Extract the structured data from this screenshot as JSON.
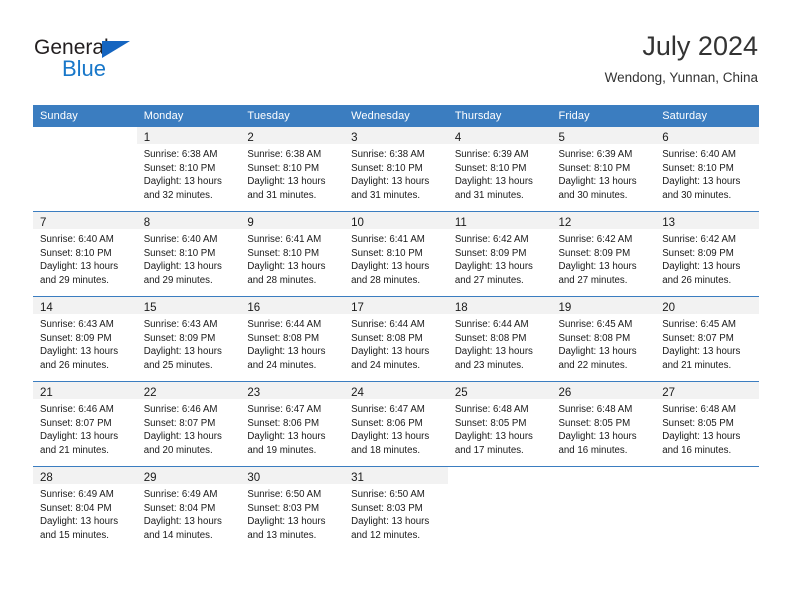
{
  "brand": {
    "name_top": "General",
    "name_bottom": "Blue",
    "accent_color": "#1877c9",
    "triangle_color": "#1565c0"
  },
  "header": {
    "title": "July 2024",
    "subtitle": "Wendong, Yunnan, China"
  },
  "theme": {
    "header_row_bg": "#3b7dc0",
    "header_row_text": "#ffffff",
    "daynum_band_bg": "#f2f2f2",
    "week_separator": "#3b7dc0",
    "text_color": "#1a1a1a"
  },
  "weekday_headers": [
    "Sunday",
    "Monday",
    "Tuesday",
    "Wednesday",
    "Thursday",
    "Friday",
    "Saturday"
  ],
  "weeks": [
    [
      {
        "day": "",
        "lines": []
      },
      {
        "day": "1",
        "lines": [
          "Sunrise: 6:38 AM",
          "Sunset: 8:10 PM",
          "Daylight: 13 hours",
          "and 32 minutes."
        ]
      },
      {
        "day": "2",
        "lines": [
          "Sunrise: 6:38 AM",
          "Sunset: 8:10 PM",
          "Daylight: 13 hours",
          "and 31 minutes."
        ]
      },
      {
        "day": "3",
        "lines": [
          "Sunrise: 6:38 AM",
          "Sunset: 8:10 PM",
          "Daylight: 13 hours",
          "and 31 minutes."
        ]
      },
      {
        "day": "4",
        "lines": [
          "Sunrise: 6:39 AM",
          "Sunset: 8:10 PM",
          "Daylight: 13 hours",
          "and 31 minutes."
        ]
      },
      {
        "day": "5",
        "lines": [
          "Sunrise: 6:39 AM",
          "Sunset: 8:10 PM",
          "Daylight: 13 hours",
          "and 30 minutes."
        ]
      },
      {
        "day": "6",
        "lines": [
          "Sunrise: 6:40 AM",
          "Sunset: 8:10 PM",
          "Daylight: 13 hours",
          "and 30 minutes."
        ]
      }
    ],
    [
      {
        "day": "7",
        "lines": [
          "Sunrise: 6:40 AM",
          "Sunset: 8:10 PM",
          "Daylight: 13 hours",
          "and 29 minutes."
        ]
      },
      {
        "day": "8",
        "lines": [
          "Sunrise: 6:40 AM",
          "Sunset: 8:10 PM",
          "Daylight: 13 hours",
          "and 29 minutes."
        ]
      },
      {
        "day": "9",
        "lines": [
          "Sunrise: 6:41 AM",
          "Sunset: 8:10 PM",
          "Daylight: 13 hours",
          "and 28 minutes."
        ]
      },
      {
        "day": "10",
        "lines": [
          "Sunrise: 6:41 AM",
          "Sunset: 8:10 PM",
          "Daylight: 13 hours",
          "and 28 minutes."
        ]
      },
      {
        "day": "11",
        "lines": [
          "Sunrise: 6:42 AM",
          "Sunset: 8:09 PM",
          "Daylight: 13 hours",
          "and 27 minutes."
        ]
      },
      {
        "day": "12",
        "lines": [
          "Sunrise: 6:42 AM",
          "Sunset: 8:09 PM",
          "Daylight: 13 hours",
          "and 27 minutes."
        ]
      },
      {
        "day": "13",
        "lines": [
          "Sunrise: 6:42 AM",
          "Sunset: 8:09 PM",
          "Daylight: 13 hours",
          "and 26 minutes."
        ]
      }
    ],
    [
      {
        "day": "14",
        "lines": [
          "Sunrise: 6:43 AM",
          "Sunset: 8:09 PM",
          "Daylight: 13 hours",
          "and 26 minutes."
        ]
      },
      {
        "day": "15",
        "lines": [
          "Sunrise: 6:43 AM",
          "Sunset: 8:09 PM",
          "Daylight: 13 hours",
          "and 25 minutes."
        ]
      },
      {
        "day": "16",
        "lines": [
          "Sunrise: 6:44 AM",
          "Sunset: 8:08 PM",
          "Daylight: 13 hours",
          "and 24 minutes."
        ]
      },
      {
        "day": "17",
        "lines": [
          "Sunrise: 6:44 AM",
          "Sunset: 8:08 PM",
          "Daylight: 13 hours",
          "and 24 minutes."
        ]
      },
      {
        "day": "18",
        "lines": [
          "Sunrise: 6:44 AM",
          "Sunset: 8:08 PM",
          "Daylight: 13 hours",
          "and 23 minutes."
        ]
      },
      {
        "day": "19",
        "lines": [
          "Sunrise: 6:45 AM",
          "Sunset: 8:08 PM",
          "Daylight: 13 hours",
          "and 22 minutes."
        ]
      },
      {
        "day": "20",
        "lines": [
          "Sunrise: 6:45 AM",
          "Sunset: 8:07 PM",
          "Daylight: 13 hours",
          "and 21 minutes."
        ]
      }
    ],
    [
      {
        "day": "21",
        "lines": [
          "Sunrise: 6:46 AM",
          "Sunset: 8:07 PM",
          "Daylight: 13 hours",
          "and 21 minutes."
        ]
      },
      {
        "day": "22",
        "lines": [
          "Sunrise: 6:46 AM",
          "Sunset: 8:07 PM",
          "Daylight: 13 hours",
          "and 20 minutes."
        ]
      },
      {
        "day": "23",
        "lines": [
          "Sunrise: 6:47 AM",
          "Sunset: 8:06 PM",
          "Daylight: 13 hours",
          "and 19 minutes."
        ]
      },
      {
        "day": "24",
        "lines": [
          "Sunrise: 6:47 AM",
          "Sunset: 8:06 PM",
          "Daylight: 13 hours",
          "and 18 minutes."
        ]
      },
      {
        "day": "25",
        "lines": [
          "Sunrise: 6:48 AM",
          "Sunset: 8:05 PM",
          "Daylight: 13 hours",
          "and 17 minutes."
        ]
      },
      {
        "day": "26",
        "lines": [
          "Sunrise: 6:48 AM",
          "Sunset: 8:05 PM",
          "Daylight: 13 hours",
          "and 16 minutes."
        ]
      },
      {
        "day": "27",
        "lines": [
          "Sunrise: 6:48 AM",
          "Sunset: 8:05 PM",
          "Daylight: 13 hours",
          "and 16 minutes."
        ]
      }
    ],
    [
      {
        "day": "28",
        "lines": [
          "Sunrise: 6:49 AM",
          "Sunset: 8:04 PM",
          "Daylight: 13 hours",
          "and 15 minutes."
        ]
      },
      {
        "day": "29",
        "lines": [
          "Sunrise: 6:49 AM",
          "Sunset: 8:04 PM",
          "Daylight: 13 hours",
          "and 14 minutes."
        ]
      },
      {
        "day": "30",
        "lines": [
          "Sunrise: 6:50 AM",
          "Sunset: 8:03 PM",
          "Daylight: 13 hours",
          "and 13 minutes."
        ]
      },
      {
        "day": "31",
        "lines": [
          "Sunrise: 6:50 AM",
          "Sunset: 8:03 PM",
          "Daylight: 13 hours",
          "and 12 minutes."
        ]
      },
      {
        "day": "",
        "lines": []
      },
      {
        "day": "",
        "lines": []
      },
      {
        "day": "",
        "lines": []
      }
    ]
  ]
}
